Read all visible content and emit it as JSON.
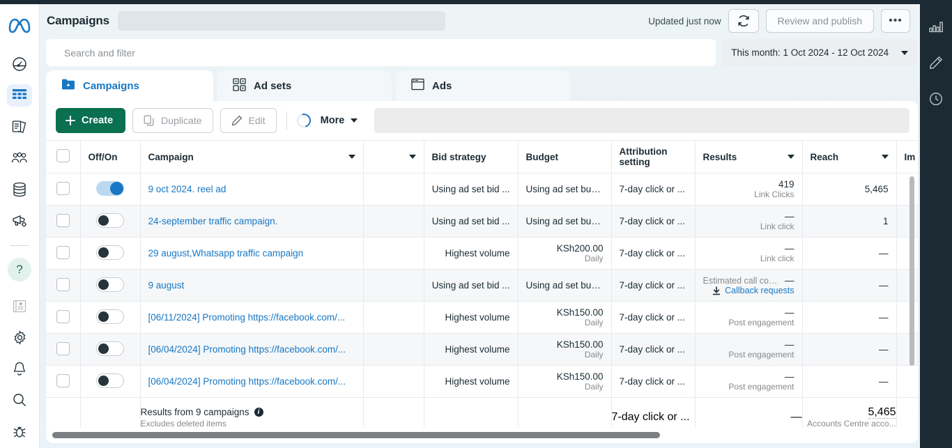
{
  "header": {
    "title": "Campaigns",
    "updated_text": "Updated just now",
    "refresh_icon": "refresh-icon",
    "review_publish_label": "Review and publish",
    "more_options_label": "•••"
  },
  "search": {
    "placeholder": "Search and filter",
    "date_range": "This month: 1 Oct 2024 - 12 Oct 2024"
  },
  "tabs": [
    {
      "label": "Campaigns",
      "icon": "campaigns-folder-icon",
      "active": true
    },
    {
      "label": "Ad sets",
      "icon": "ad-sets-grid-icon",
      "active": false
    },
    {
      "label": "Ads",
      "icon": "ads-window-icon",
      "active": false
    }
  ],
  "toolbar": {
    "create_label": "Create",
    "duplicate_label": "Duplicate",
    "edit_label": "Edit",
    "more_label": "More"
  },
  "sidebar": {
    "logo": "meta-logo",
    "items": [
      {
        "name": "dashboard-gauge-icon",
        "label": "Dashboard"
      },
      {
        "name": "table-icon",
        "label": "Campaigns",
        "active": true
      },
      {
        "name": "pages-icon",
        "label": "Pages"
      },
      {
        "name": "audiences-people-icon",
        "label": "Audiences"
      },
      {
        "name": "billing-coins-icon",
        "label": "Billing"
      },
      {
        "name": "megaphone-icon",
        "label": "Ads"
      }
    ],
    "bottom_items": [
      {
        "name": "help-question-icon",
        "label": "Help"
      },
      {
        "name": "news-receipt-icon",
        "label": "News"
      },
      {
        "name": "settings-gear-icon",
        "label": "Settings"
      },
      {
        "name": "notifications-bell-icon",
        "label": "Notifications"
      },
      {
        "name": "search-icon",
        "label": "Search"
      },
      {
        "name": "bug-icon",
        "label": "Report a bug"
      }
    ]
  },
  "right_rail": {
    "items": [
      {
        "name": "bar-chart-icon",
        "label": "Charts"
      },
      {
        "name": "pencil-icon",
        "label": "Edit"
      },
      {
        "name": "clock-icon",
        "label": "History"
      }
    ]
  },
  "table": {
    "columns": [
      {
        "key": "select",
        "label": ""
      },
      {
        "key": "offon",
        "label": "Off/On"
      },
      {
        "key": "campaign",
        "label": "Campaign",
        "sortable": true
      },
      {
        "key": "delivery",
        "label": "",
        "sortable": true
      },
      {
        "key": "bid_strategy",
        "label": "Bid strategy"
      },
      {
        "key": "budget",
        "label": "Budget"
      },
      {
        "key": "attribution",
        "label": "Attribution setting"
      },
      {
        "key": "results",
        "label": "Results",
        "sortable": true
      },
      {
        "key": "reach",
        "label": "Reach",
        "sortable": true
      },
      {
        "key": "impressions",
        "label": "Im"
      }
    ],
    "rows": [
      {
        "toggle": "on",
        "campaign": "9 oct 2024. reel ad",
        "bid_strategy": "Using ad set bid ...",
        "budget_main": "Using ad set bud...",
        "budget_sub": "",
        "attribution": "7-day click or ...",
        "results_value": "419",
        "results_label": "Link Clicks",
        "results_prefix": "",
        "results_link": "",
        "reach": "5,465"
      },
      {
        "toggle": "off",
        "campaign": "24-september traffic campaign.",
        "bid_strategy": "Using ad set bid ...",
        "budget_main": "Using ad set bud...",
        "budget_sub": "",
        "attribution": "7-day click or ...",
        "results_value": "—",
        "results_label": "Link click",
        "results_prefix": "",
        "results_link": "",
        "reach": "1"
      },
      {
        "toggle": "off",
        "campaign": "29 august,Whatsapp traffic campaign",
        "bid_strategy": "Highest volume",
        "budget_main": "KSh200.00",
        "budget_sub": "Daily",
        "attribution": "7-day click or ...",
        "results_value": "—",
        "results_label": "Link click",
        "results_prefix": "",
        "results_link": "",
        "reach": "—"
      },
      {
        "toggle": "off",
        "campaign": "9 august",
        "bid_strategy": "Using ad set bid ...",
        "budget_main": "Using ad set bud...",
        "budget_sub": "",
        "attribution": "7-day click or ...",
        "results_value": "—",
        "results_label": "",
        "results_prefix": "Estimated call confi...",
        "results_link": "Callback requests",
        "reach": "—"
      },
      {
        "toggle": "off",
        "campaign": "[06/11/2024] Promoting https://facebook.com/...",
        "bid_strategy": "Highest volume",
        "budget_main": "KSh150.00",
        "budget_sub": "Daily",
        "attribution": "7-day click or ...",
        "results_value": "—",
        "results_label": "Post engagement",
        "results_prefix": "",
        "results_link": "",
        "reach": "—"
      },
      {
        "toggle": "off",
        "campaign": "[06/04/2024] Promoting https://facebook.com/...",
        "bid_strategy": "Highest volume",
        "budget_main": "KSh150.00",
        "budget_sub": "Daily",
        "attribution": "7-day click or ...",
        "results_value": "—",
        "results_label": "Post engagement",
        "results_prefix": "",
        "results_link": "",
        "reach": "—"
      },
      {
        "toggle": "off",
        "campaign": "[06/04/2024] Promoting https://facebook.com/...",
        "bid_strategy": "Highest volume",
        "budget_main": "KSh150.00",
        "budget_sub": "Daily",
        "attribution": "7-day click or ...",
        "results_value": "—",
        "results_label": "Post engagement",
        "results_prefix": "",
        "results_link": "",
        "reach": "—"
      }
    ],
    "summary": {
      "title": "Results from 9 campaigns",
      "subtitle": "Excludes deleted items",
      "attribution": "7-day click or ...",
      "results": "—",
      "reach": "5,465",
      "reach_label": "Accounts Centre acco..."
    }
  },
  "colors": {
    "brand_blue": "#1877c4",
    "create_green": "#0a7050",
    "dark_rail": "#1c2b33",
    "toggle_on": "#1877c4"
  }
}
